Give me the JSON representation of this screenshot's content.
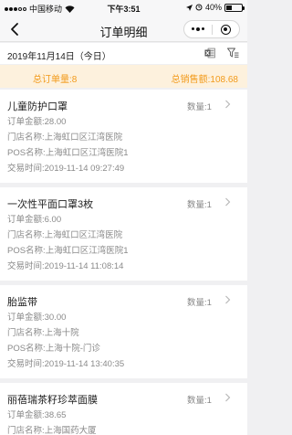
{
  "status_bar": {
    "carrier": "中国移动",
    "time": "下午3:51",
    "battery": "40%",
    "battery_level": 0.4
  },
  "nav": {
    "title": "订单明细"
  },
  "header": {
    "date": "2019年11月14日（今日）"
  },
  "summary": {
    "total_orders": "总订单量:8",
    "total_sales": "总销售额:108.68"
  },
  "orders": [
    {
      "name": "儿童防护口罩",
      "qty": "数量:1",
      "amount": "订单金额:28.00",
      "store": "门店名称:上海虹口区江湾医院",
      "pos": "POS名称:上海虹口区江湾医院1",
      "time": "交易时间:2019-11-14 09:27:49"
    },
    {
      "name": "一次性平面口罩3枚",
      "qty": "数量:1",
      "amount": "订单金额:6.00",
      "store": "门店名称:上海虹口区江湾医院",
      "pos": "POS名称:上海虹口区江湾医院1",
      "time": "交易时间:2019-11-14 11:08:14"
    },
    {
      "name": "胎监带",
      "qty": "数量:1",
      "amount": "订单金额:30.00",
      "store": "门店名称:上海十院",
      "pos": "POS名称:上海十院-门诊",
      "time": "交易时间:2019-11-14 13:40:35"
    },
    {
      "name": "丽蓓瑞茶籽珍萃面膜",
      "qty": "数量:1",
      "amount": "订单金额:38.65",
      "store": "门店名称:上海国药大厦",
      "pos": "",
      "time": ""
    }
  ]
}
